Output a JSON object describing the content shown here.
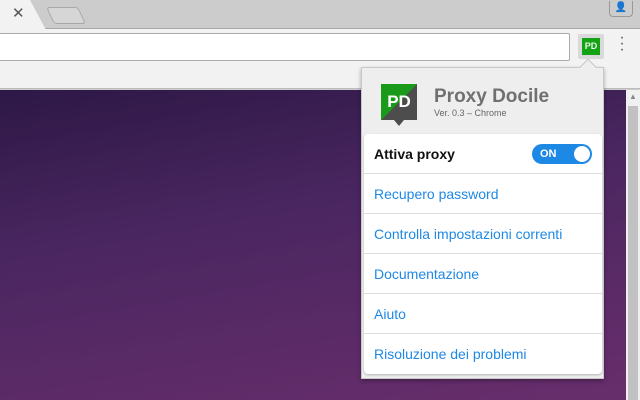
{
  "browser": {
    "tab_close": "✕",
    "profile_icon": "person-icon",
    "extension_badge": "PD",
    "menu": "⋮"
  },
  "popup": {
    "logo": "PD",
    "title": "Proxy Docile",
    "version": "Ver. 0.3 – Chrome",
    "toggle_label": "Attiva proxy",
    "toggle_state": "ON",
    "items": [
      "Recupero password",
      "Controlla impostazioni correnti",
      "Documentazione",
      "Aiuto",
      "Risoluzione dei problemi"
    ]
  },
  "colors": {
    "accent": "#1e88e5",
    "logo_green": "#1a9a1a"
  }
}
